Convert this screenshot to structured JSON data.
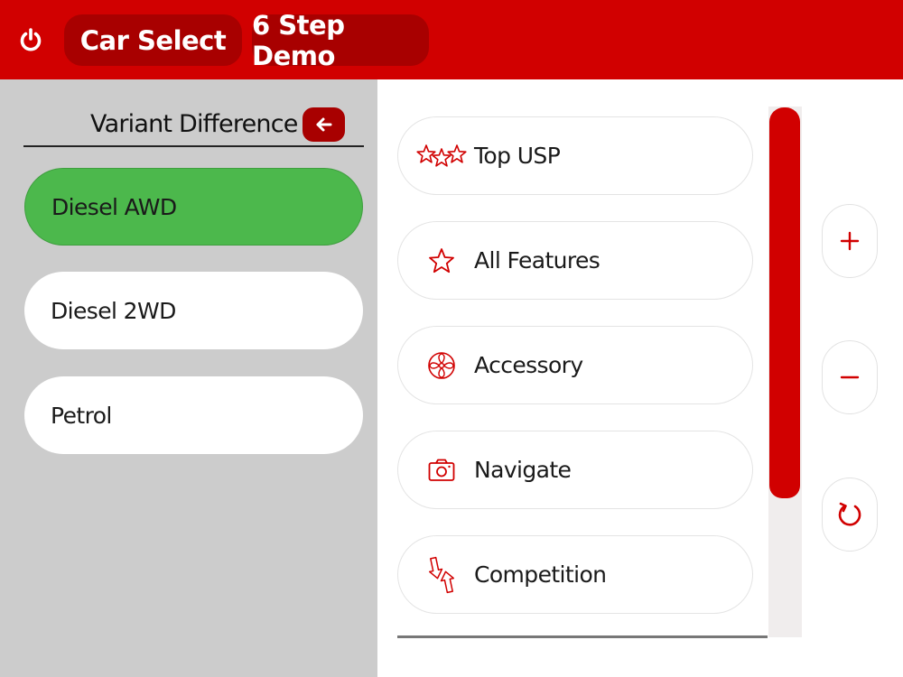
{
  "colors": {
    "brand_red": "#d10000",
    "dark_red": "#a80000",
    "selected_green": "#4cb84c",
    "panel_gray": "#cccccc"
  },
  "header": {
    "power_icon": "power-icon",
    "car_select_label": "Car Select",
    "demo_label": "6 Step Demo"
  },
  "left_panel": {
    "title": "Variant Difference",
    "back_icon": "arrow-left-icon",
    "variants": [
      {
        "label": "Diesel AWD",
        "selected": true
      },
      {
        "label": "Diesel 2WD",
        "selected": false
      },
      {
        "label": "Petrol",
        "selected": false
      }
    ]
  },
  "features": [
    {
      "label": "Top USP",
      "icon": "three-stars-icon"
    },
    {
      "label": "All Features",
      "icon": "star-icon"
    },
    {
      "label": "Accessory",
      "icon": "fan-icon"
    },
    {
      "label": "Navigate",
      "icon": "camera-icon"
    },
    {
      "label": "Competition",
      "icon": "swap-arrows-icon"
    }
  ],
  "controls": {
    "zoom_in_icon": "plus-icon",
    "zoom_out_icon": "minus-icon",
    "reset_icon": "refresh-icon"
  }
}
